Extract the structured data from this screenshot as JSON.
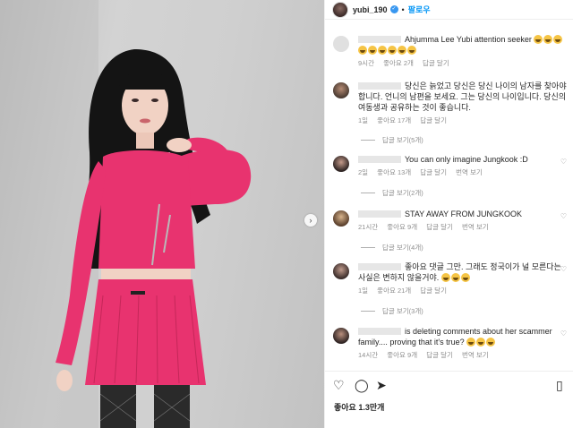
{
  "header": {
    "username": "yubi_190",
    "follow_label": "팔로우"
  },
  "comments": [
    {
      "text": "Ahjumma Lee Yubi attention seeker",
      "emoji_count": 9,
      "time": "9시간",
      "likes": "좋아요 2개",
      "reply": "답글 달기"
    },
    {
      "text": "당신은 늙었고 당신은 당신 나이의 남자를 찾아야합니다. 언니의 남편을 보세요. 그는 당신의 나이입니다. 당신의 여동생과 공유하는 것이 좋습니다.",
      "time": "1일",
      "likes": "좋아요 17개",
      "reply": "답글 달기",
      "view_replies": "답글 보기(5개)"
    },
    {
      "text": "You can only imagine Jungkook :D",
      "time": "2일",
      "likes": "좋아요 13개",
      "reply": "답글 달기",
      "translate": "번역 보기",
      "view_replies": "답글 보기(2개)"
    },
    {
      "text": "STAY AWAY FROM JUNGKOOK",
      "time": "21시간",
      "likes": "좋아요 9개",
      "reply": "답글 달기",
      "translate": "번역 보기",
      "view_replies": "답글 보기(4개)"
    },
    {
      "text": "좋아요 댓글 그만. 그래도 정국이가 널 모른다는 사실은 변하지 않을거야.",
      "emoji_count": 3,
      "time": "1일",
      "likes": "좋아요 21개",
      "reply": "답글 달기",
      "view_replies": "답글 보기(3개)"
    },
    {
      "text": "is deleting comments about her scammer family.... proving that it's true?",
      "emoji_count": 3,
      "time": "14시간",
      "likes": "좋아요 9개",
      "reply": "답글 달기",
      "translate": "번역 보기"
    }
  ],
  "actions": {
    "likes_label": "좋아요 1.3만개"
  },
  "icons": [
    "heart-icon",
    "comment-icon",
    "share-icon",
    "bookmark-icon",
    "next-arrow-icon",
    "verified-badge-icon"
  ],
  "colors": {
    "outfit_pink": "#e8336f",
    "link_blue": "#0095f6",
    "meta_gray": "#8e8e8e"
  }
}
